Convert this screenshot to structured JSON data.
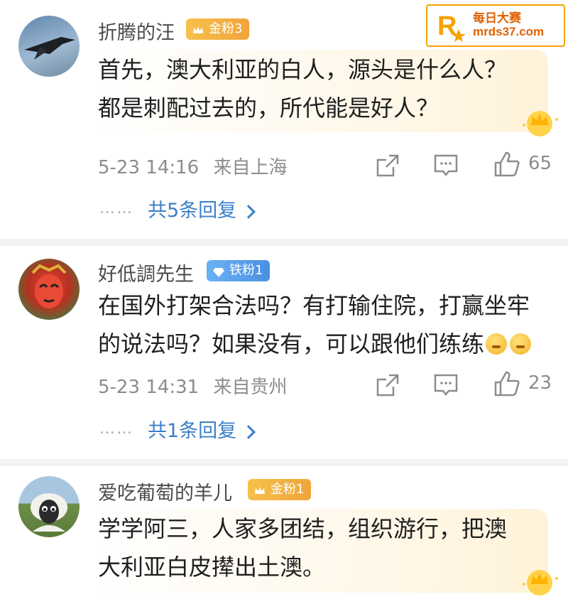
{
  "watermark": {
    "brand": "每日大赛",
    "url": "mrds37.com",
    "logo_letter": "R"
  },
  "comments": [
    {
      "username": "折腾的汪",
      "badge": "金粉3",
      "lines": [
        "首先，澳大利亚的白人，源头是什么人？",
        "都是刺配过去的，所代能是好人？"
      ],
      "timestamp": "5-23 14:16",
      "location": "来自上海",
      "likes": "65",
      "replies": "共5条回复",
      "dots": "……"
    },
    {
      "username": "好低調先生",
      "badge": "铁粉1",
      "lines": [
        "在国外打架合法吗？有打输住院，打赢坐牢",
        "的说法吗？如果没有，可以跟他们练练"
      ],
      "timestamp": "5-23 14:31",
      "location": "来自贵州",
      "likes": "23",
      "replies": "共1条回复",
      "dots": "……"
    },
    {
      "username": "爱吃葡萄的羊儿",
      "badge": "金粉1",
      "lines": [
        "学学阿三，人家多团结，组织游行，把澳",
        "大利亚白皮撵出土澳。"
      ]
    }
  ],
  "colors": {
    "link": "#3b7fc8",
    "meta": "#8c8c8c",
    "gold_badge": "#f0a53a",
    "iron_badge": "#4a90e2"
  },
  "icons": [
    "share-icon",
    "comment-icon",
    "like-icon",
    "crown-icon",
    "diamond-icon",
    "emoji-icon"
  ]
}
